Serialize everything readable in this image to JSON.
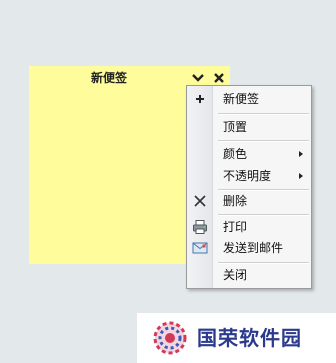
{
  "note": {
    "title": "新便签",
    "background": "#fffc9b"
  },
  "menu": {
    "items": [
      {
        "label": "新便签",
        "icon": "plus-icon"
      },
      {
        "label": "顶置"
      },
      {
        "label": "颜色",
        "submenu": true
      },
      {
        "label": "不透明度",
        "submenu": true
      },
      {
        "label": "删除",
        "icon": "delete-x-icon"
      },
      {
        "label": "打印",
        "icon": "printer-icon"
      },
      {
        "label": "发送到邮件",
        "icon": "email-icon"
      },
      {
        "label": "关闭"
      }
    ]
  },
  "watermark": {
    "text": "国荣软件园",
    "color": "#2b3a8c"
  }
}
